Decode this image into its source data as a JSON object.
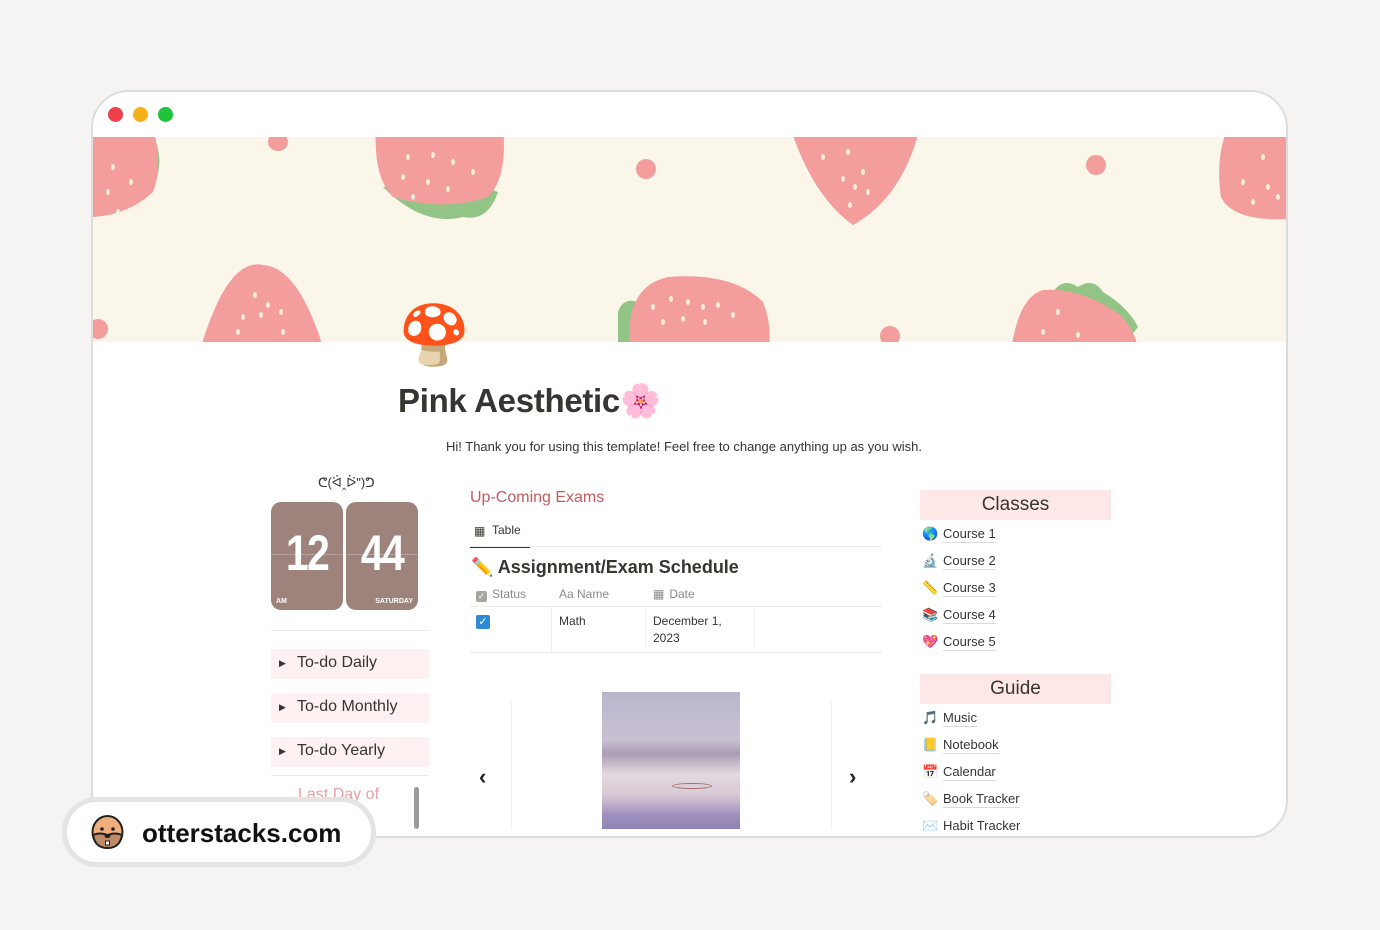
{
  "window": {
    "controls": [
      "close",
      "minimize",
      "zoom"
    ]
  },
  "page": {
    "icon": "🍄",
    "title": "Pink Aesthetic🌸",
    "intro": "Hi! Thank you for using this template! Feel free to change anything up as you wish."
  },
  "clock": {
    "kaomoji": "ᕦ(ᐛ‸ᐖ\")ᕤ",
    "hour": "12",
    "minute": "44",
    "period": "AM",
    "day": "SATURDAY"
  },
  "toggles": [
    {
      "label": "To-do Daily"
    },
    {
      "label": "To-do Monthly"
    },
    {
      "label": "To-do Yearly"
    }
  ],
  "countdown": {
    "label": "Last Day of School"
  },
  "exams": {
    "section_title": "Up-Coming Exams",
    "view_tab": "Table",
    "database_title": "✏️ Assignment/Exam Schedule",
    "columns": [
      {
        "icon": "checkbox-icon",
        "label": "Status"
      },
      {
        "icon": "text-icon",
        "label": "Aa Name"
      },
      {
        "icon": "calendar-icon",
        "label": "Date"
      }
    ],
    "rows": [
      {
        "status": true,
        "name": "Math",
        "date": "December 1, 2023"
      }
    ]
  },
  "gallery": {
    "prev": "‹",
    "next": "›"
  },
  "classes": {
    "title": "Classes",
    "items": [
      {
        "emoji": "🌎",
        "label": "Course 1"
      },
      {
        "emoji": "🔬",
        "label": "Course 2"
      },
      {
        "emoji": "📏",
        "label": "Course 3"
      },
      {
        "emoji": "📚",
        "label": "Course 4"
      },
      {
        "emoji": "💖",
        "label": "Course 5"
      }
    ]
  },
  "guide": {
    "title": "Guide",
    "items": [
      {
        "emoji": "🎵",
        "label": "Music"
      },
      {
        "emoji": "📒",
        "label": "Notebook"
      },
      {
        "emoji": "📅",
        "label": "Calendar"
      },
      {
        "emoji": "🏷️",
        "label": "Book Tracker"
      },
      {
        "emoji": "✉️",
        "label": "Habit Tracker"
      }
    ]
  },
  "watermark": {
    "text": "otterstacks.com"
  },
  "colors": {
    "accent_pink": "#c55a5f",
    "header_pink": "#fde7e7",
    "toggle_bg": "#fdf1f1",
    "clock_bg": "#9e837c",
    "cover_bg": "#faf6ea",
    "strawberry": "#f49d9d",
    "leaf": "#92c486",
    "checkbox_blue": "#2f8bd6"
  }
}
